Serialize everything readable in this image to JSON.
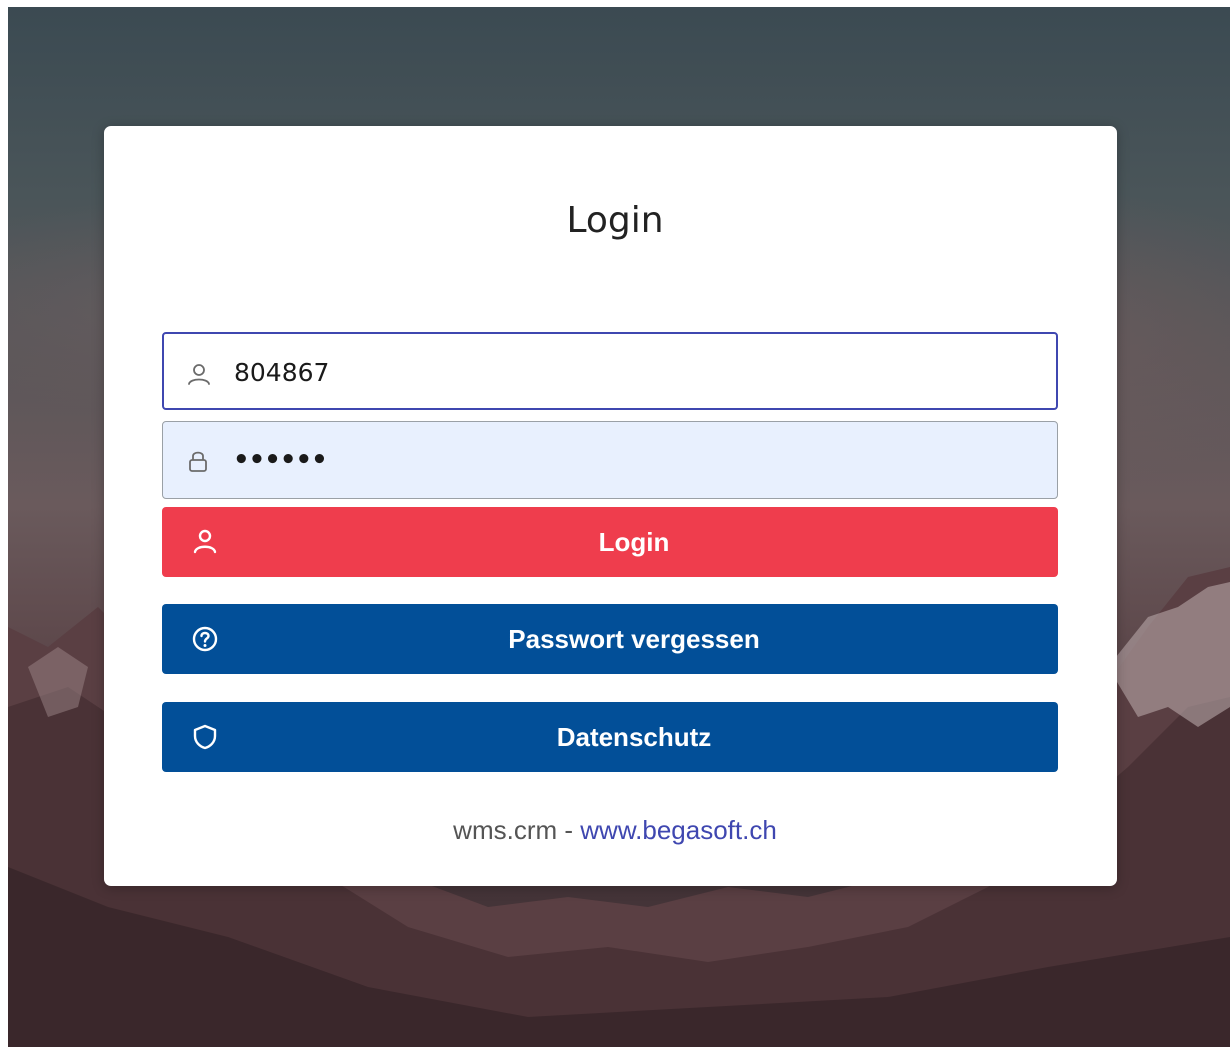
{
  "page": {
    "title": "Login"
  },
  "form": {
    "username": {
      "value": "804867",
      "icon": "user-icon"
    },
    "password": {
      "value": "••••••",
      "icon": "lock-icon"
    }
  },
  "buttons": {
    "login": {
      "label": "Login",
      "icon": "user-icon",
      "color": "#ef3d4d"
    },
    "forgot_password": {
      "label": "Passwort vergessen",
      "icon": "question-circle-icon",
      "color": "#024f98"
    },
    "privacy": {
      "label": "Datenschutz",
      "icon": "shield-icon",
      "color": "#024f98"
    }
  },
  "footer": {
    "prefix": "wms.crm - ",
    "link_text": "www.begasoft.ch"
  },
  "colors": {
    "focus_border": "#3f47b0",
    "autofill_bg": "#e8f0fe",
    "link": "#3f47b0"
  }
}
